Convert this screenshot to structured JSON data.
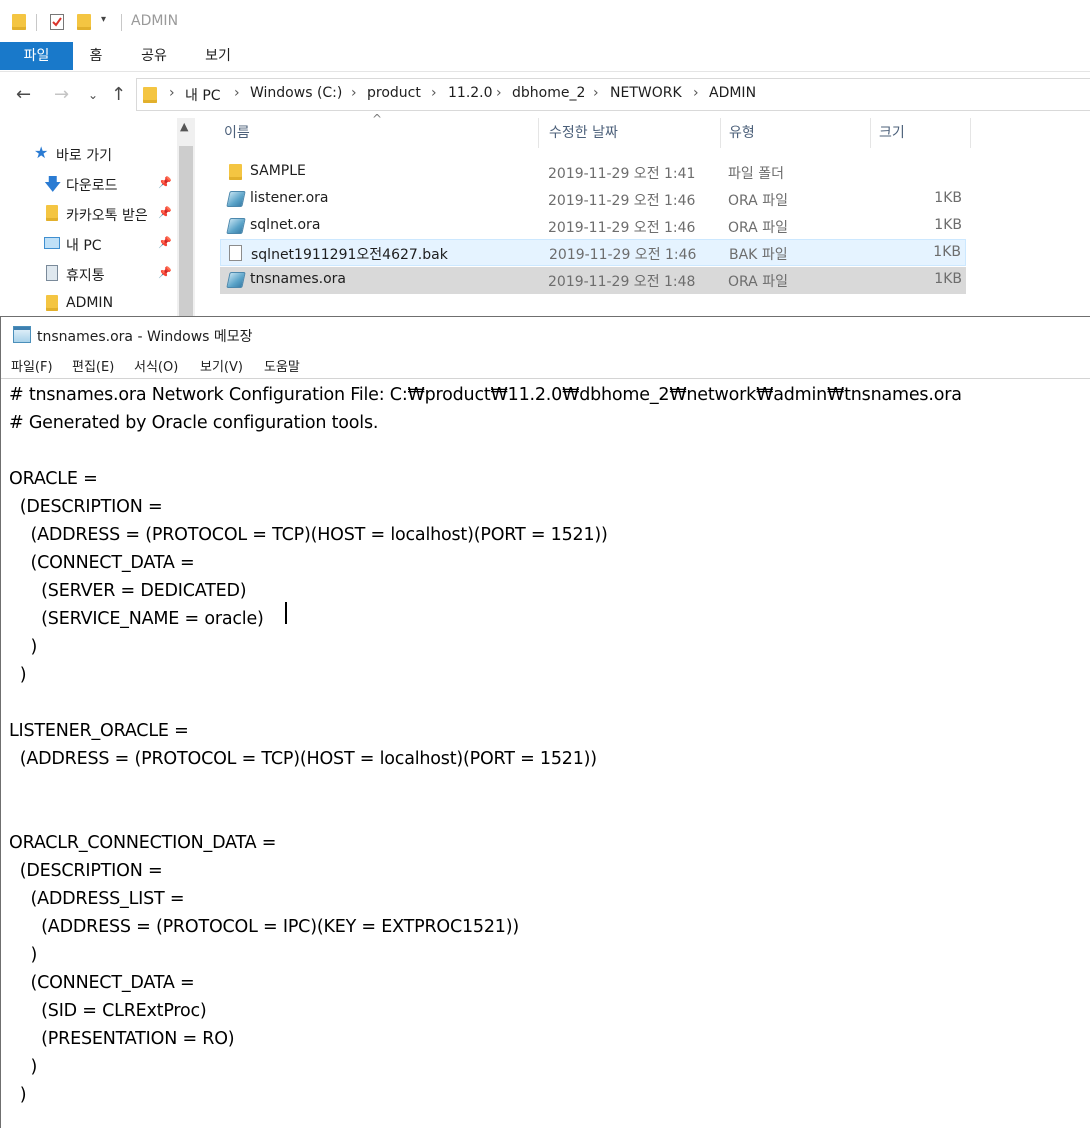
{
  "explorer": {
    "qat_title": "ADMIN",
    "ribbon_tabs": [
      "파일",
      "홈",
      "공유",
      "보기"
    ],
    "address": {
      "crumbs": [
        "내 PC",
        "Windows (C:)",
        "product",
        "11.2.0",
        "dbhome_2",
        "NETWORK",
        "ADMIN"
      ]
    },
    "nav": {
      "items": [
        {
          "label": "바로 가기",
          "icon": "star-icon"
        },
        {
          "label": "다운로드",
          "icon": "download-icon",
          "pinned": true
        },
        {
          "label": "카카오톡 받은",
          "icon": "folder-icon",
          "pinned": true
        },
        {
          "label": "내 PC",
          "icon": "computer-icon",
          "pinned": true
        },
        {
          "label": "휴지통",
          "icon": "recycle-bin-icon",
          "pinned": true
        },
        {
          "label": "ADMIN",
          "icon": "folder-icon"
        }
      ]
    },
    "columns": {
      "name": "이름",
      "date": "수정한 날짜",
      "type": "유형",
      "size": "크기"
    },
    "files": [
      {
        "name": "SAMPLE",
        "date": "2019-11-29 오전 1:41",
        "type": "파일 폴더",
        "size": "",
        "icon": "folder-icon"
      },
      {
        "name": "listener.ora",
        "date": "2019-11-29 오전 1:46",
        "type": "ORA 파일",
        "size": "1KB",
        "icon": "ora-file-icon"
      },
      {
        "name": "sqlnet.ora",
        "date": "2019-11-29 오전 1:46",
        "type": "ORA 파일",
        "size": "1KB",
        "icon": "ora-file-icon"
      },
      {
        "name": "sqlnet1911291오전4627.bak",
        "date": "2019-11-29 오전 1:46",
        "type": "BAK 파일",
        "size": "1KB",
        "icon": "bak-file-icon"
      },
      {
        "name": "tnsnames.ora",
        "date": "2019-11-29 오전 1:48",
        "type": "ORA 파일",
        "size": "1KB",
        "icon": "ora-file-icon"
      }
    ]
  },
  "notepad": {
    "title": "tnsnames.ora - Windows 메모장",
    "menu": [
      "파일(F)",
      "편집(E)",
      "서식(O)",
      "보기(V)",
      "도움말"
    ],
    "lines": [
      "# tnsnames.ora Network Configuration File: C:₩product₩11.2.0₩dbhome_2₩network₩admin₩tnsnames.ora",
      "# Generated by Oracle configuration tools.",
      "",
      "ORACLE =",
      "  (DESCRIPTION =",
      "    (ADDRESS = (PROTOCOL = TCP)(HOST = localhost)(PORT = 1521))",
      "    (CONNECT_DATA =",
      "      (SERVER = DEDICATED)",
      "      (SERVICE_NAME = oracle)",
      "    )",
      "  )",
      "",
      "LISTENER_ORACLE =",
      "  (ADDRESS = (PROTOCOL = TCP)(HOST = localhost)(PORT = 1521))",
      "",
      "",
      "ORACLR_CONNECTION_DATA =",
      "  (DESCRIPTION =",
      "    (ADDRESS_LIST =",
      "      (ADDRESS = (PROTOCOL = IPC)(KEY = EXTPROC1521))",
      "    )",
      "    (CONNECT_DATA =",
      "      (SID = CLRExtProc)",
      "      (PRESENTATION = RO)",
      "    )",
      "  )"
    ]
  }
}
